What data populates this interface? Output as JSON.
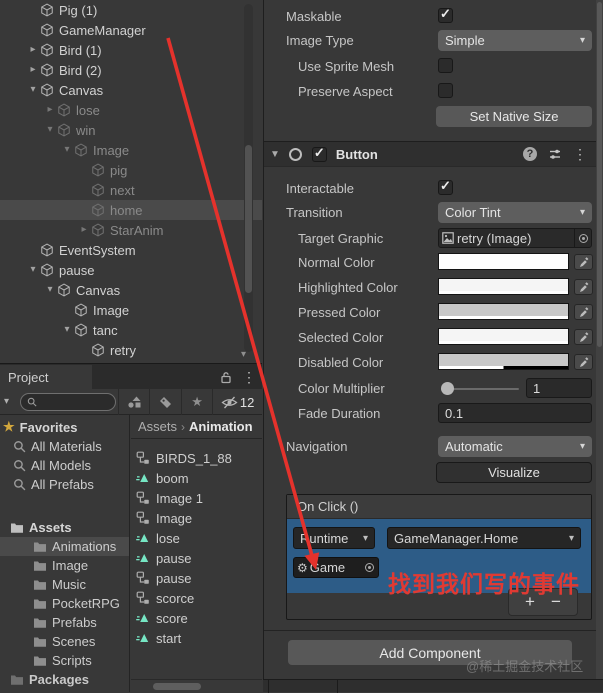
{
  "hierarchy": {
    "items": [
      {
        "label": "Pig (1)",
        "indent": 0,
        "fold": "none",
        "dim": false,
        "selected": false
      },
      {
        "label": "GameManager",
        "indent": 0,
        "fold": "none",
        "dim": false,
        "selected": false
      },
      {
        "label": "Bird (1)",
        "indent": 0,
        "fold": "closed",
        "dim": false,
        "selected": false
      },
      {
        "label": "Bird (2)",
        "indent": 0,
        "fold": "closed",
        "dim": false,
        "selected": false
      },
      {
        "label": "Canvas",
        "indent": 0,
        "fold": "open",
        "dim": false,
        "selected": false
      },
      {
        "label": "lose",
        "indent": 1,
        "fold": "closed",
        "dim": true,
        "selected": false
      },
      {
        "label": "win",
        "indent": 1,
        "fold": "open",
        "dim": true,
        "selected": false
      },
      {
        "label": "Image",
        "indent": 2,
        "fold": "open",
        "dim": true,
        "selected": false
      },
      {
        "label": "pig",
        "indent": 3,
        "fold": "none",
        "dim": true,
        "selected": false
      },
      {
        "label": "next",
        "indent": 3,
        "fold": "none",
        "dim": true,
        "selected": false
      },
      {
        "label": "home",
        "indent": 3,
        "fold": "none",
        "dim": true,
        "selected": true
      },
      {
        "label": "StarAnim",
        "indent": 3,
        "fold": "closed",
        "dim": true,
        "selected": false
      },
      {
        "label": "EventSystem",
        "indent": 0,
        "fold": "none",
        "dim": false,
        "selected": false
      },
      {
        "label": "pause",
        "indent": 0,
        "fold": "open",
        "dim": false,
        "selected": false
      },
      {
        "label": "Canvas",
        "indent": 1,
        "fold": "open",
        "dim": false,
        "selected": false
      },
      {
        "label": "Image",
        "indent": 2,
        "fold": "none",
        "dim": false,
        "selected": false
      },
      {
        "label": "tanc",
        "indent": 2,
        "fold": "open",
        "dim": false,
        "selected": false
      },
      {
        "label": "retry",
        "indent": 3,
        "fold": "none",
        "dim": false,
        "selected": false
      }
    ]
  },
  "project": {
    "tab_label": "Project",
    "favorites_header": "Favorites",
    "favorites": [
      {
        "label": "All Materials"
      },
      {
        "label": "All Models"
      },
      {
        "label": "All Prefabs"
      }
    ],
    "assets_root": "Assets",
    "folders": [
      {
        "label": "Animations",
        "selected": true
      },
      {
        "label": "Image",
        "selected": false
      },
      {
        "label": "Music",
        "selected": false
      },
      {
        "label": "PocketRPG",
        "selected": false
      },
      {
        "label": "Prefabs",
        "selected": false
      },
      {
        "label": "Scenes",
        "selected": false
      },
      {
        "label": "Scripts",
        "selected": false
      }
    ],
    "packages_root": "Packages",
    "breadcrumb": {
      "root": "Assets",
      "sep": "›",
      "current": "Animation"
    },
    "hidden_count": "12",
    "search_placeholder": ""
  },
  "files": {
    "items": [
      {
        "label": "BIRDS_1_88",
        "icon": "ctrl"
      },
      {
        "label": "boom",
        "icon": "clip"
      },
      {
        "label": "Image 1",
        "icon": "ctrl"
      },
      {
        "label": "Image",
        "icon": "ctrl"
      },
      {
        "label": "lose",
        "icon": "clip"
      },
      {
        "label": "pause",
        "icon": "clip"
      },
      {
        "label": "pause",
        "icon": "ctrl"
      },
      {
        "label": "scorce",
        "icon": "ctrl"
      },
      {
        "label": "score",
        "icon": "clip"
      },
      {
        "label": "start",
        "icon": "clip"
      }
    ]
  },
  "inspector": {
    "image": {
      "maskable_label": "Maskable",
      "maskable_checked": true,
      "image_type_label": "Image Type",
      "image_type_value": "Simple",
      "use_sprite_mesh_label": "Use Sprite Mesh",
      "use_sprite_mesh_checked": false,
      "preserve_aspect_label": "Preserve Aspect",
      "preserve_aspect_checked": false,
      "set_native_size_label": "Set Native Size"
    },
    "button": {
      "title": "Button",
      "enabled_checked": true,
      "interactable_label": "Interactable",
      "interactable_checked": true,
      "transition_label": "Transition",
      "transition_value": "Color Tint",
      "target_graphic_label": "Target Graphic",
      "target_graphic_value": "retry (Image)",
      "colors": [
        {
          "label": "Normal Color",
          "hex": "#FFFFFF",
          "alpha": 1
        },
        {
          "label": "Highlighted Color",
          "hex": "#F5F5F5",
          "alpha": 1
        },
        {
          "label": "Pressed Color",
          "hex": "#C8C8C8",
          "alpha": 1
        },
        {
          "label": "Selected Color",
          "hex": "#F5F5F5",
          "alpha": 1
        },
        {
          "label": "Disabled Color",
          "hex": "#C8C8C8",
          "alpha": 0.5
        }
      ],
      "color_multiplier_label": "Color Multiplier",
      "color_multiplier_value": "1",
      "fade_duration_label": "Fade Duration",
      "fade_duration_value": "0.1",
      "navigation_label": "Navigation",
      "navigation_value": "Automatic",
      "visualize_label": "Visualize",
      "on_click": {
        "header": "On Click ()",
        "runtime_value": "Runtime",
        "handler_value": "GameManager.Home",
        "target_value": "Game",
        "add_label": "+",
        "remove_label": "−"
      }
    },
    "add_component_label": "Add Component"
  },
  "annotation": {
    "text": "找到我们写的事件",
    "color": "#E03A33"
  },
  "watermark": "@稀土掘金技术社区",
  "icons": {
    "kebab": "⋮",
    "chevron": "▾",
    "gear": "⚙",
    "star": "★",
    "caret": "▾"
  },
  "colors": {
    "selection_blue": "#2D5C87",
    "accent_red": "#E5322C"
  }
}
